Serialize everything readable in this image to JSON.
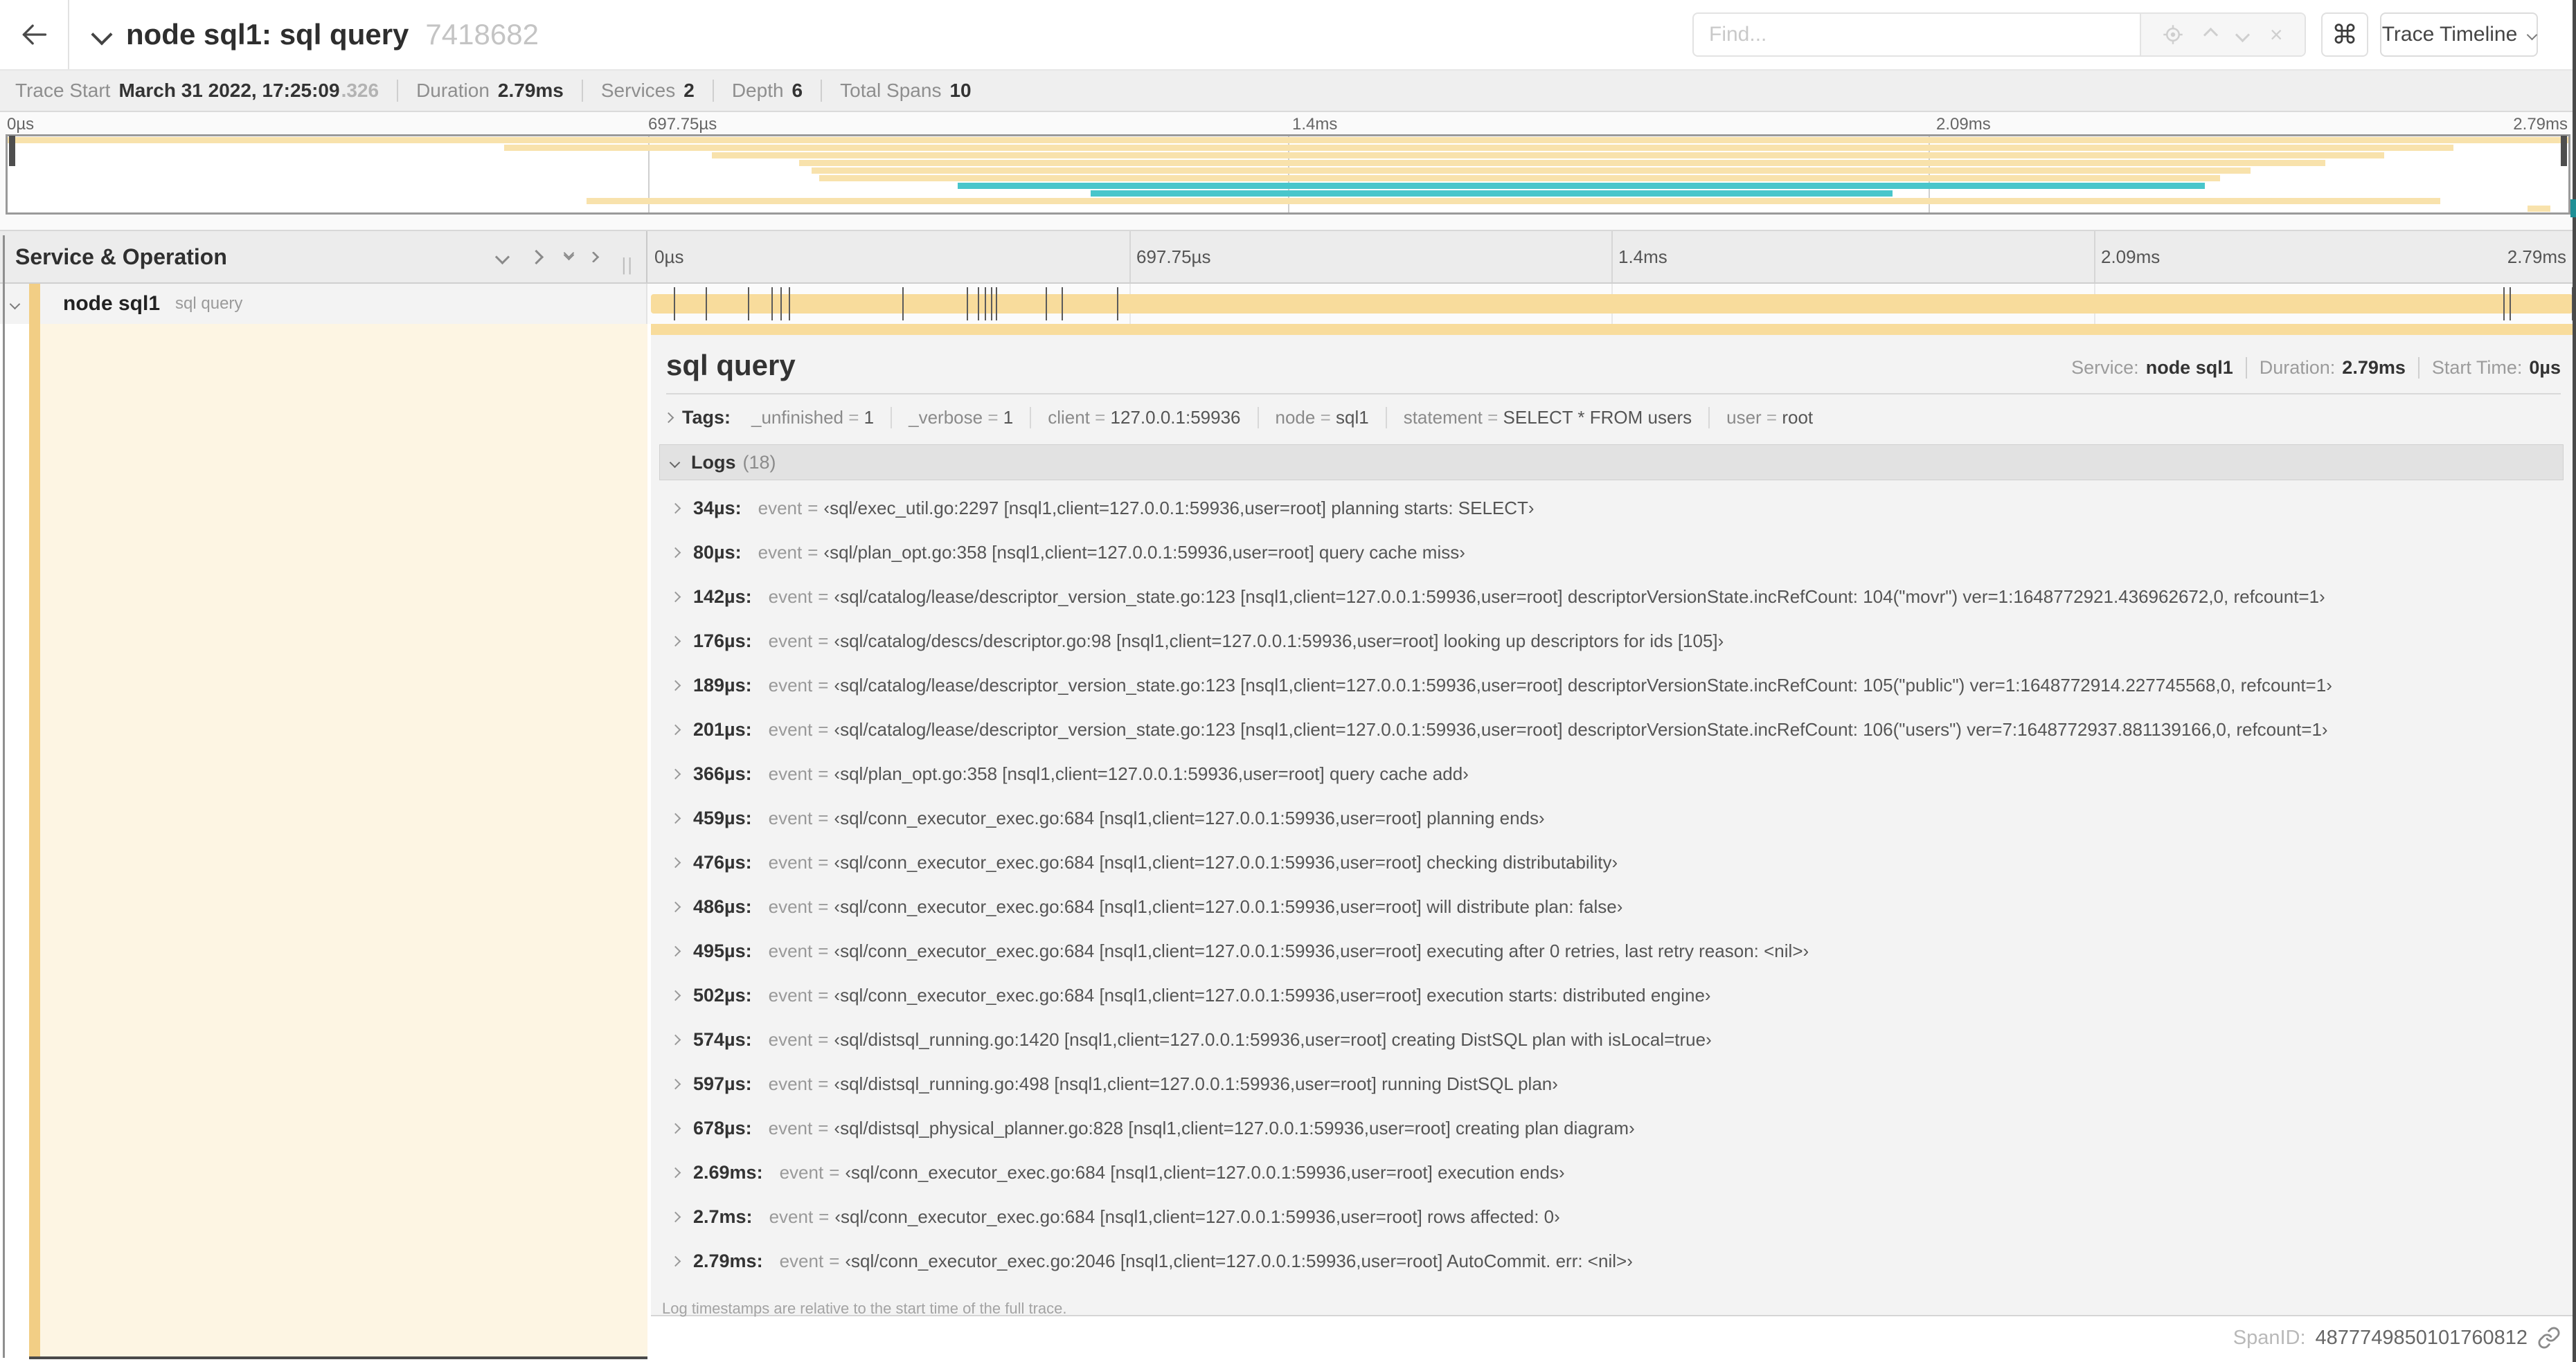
{
  "colors": {
    "tan": "#F8E2AC",
    "teal": "#49C6CB",
    "bar": "#F8DC9C",
    "accent": "#F2CE85",
    "cream": "#FDF5E3"
  },
  "header": {
    "title": "node sql1: sql query",
    "trace_id_short": "7418682",
    "find_placeholder": "Find...",
    "shortcuts_glyph": "⌘",
    "view_selector_label": "Trace Timeline"
  },
  "info_bar": {
    "items": [
      {
        "label": "Trace Start",
        "value": "March 31 2022, 17:25:09",
        "suffix": ".326"
      },
      {
        "label": "Duration",
        "value": "2.79ms",
        "suffix": ""
      },
      {
        "label": "Services",
        "value": "2",
        "suffix": ""
      },
      {
        "label": "Depth",
        "value": "6",
        "suffix": ""
      },
      {
        "label": "Total Spans",
        "value": "10",
        "suffix": ""
      }
    ]
  },
  "timeline": {
    "duration_us": 2790,
    "ticks": [
      "0µs",
      "697.75µs",
      "1.4ms",
      "2.09ms",
      "2.79ms"
    ]
  },
  "minimap": {
    "rows": [
      {
        "start": 0,
        "end": 100,
        "color": "tan"
      },
      {
        "start": 19.4,
        "end": 95.5,
        "color": "tan"
      },
      {
        "start": 27.5,
        "end": 92.8,
        "color": "tan"
      },
      {
        "start": 30.9,
        "end": 90.5,
        "color": "tan"
      },
      {
        "start": 31.4,
        "end": 87.6,
        "color": "tan"
      },
      {
        "start": 31.7,
        "end": 86.4,
        "color": "tan"
      },
      {
        "start": 37.1,
        "end": 85.8,
        "color": "teal"
      },
      {
        "start": 42.3,
        "end": 73.6,
        "color": "teal"
      },
      {
        "start": 22.6,
        "end": 95.0,
        "color": "tan"
      },
      {
        "start": 98.4,
        "end": 99.3,
        "color": "tan"
      }
    ]
  },
  "columns_header": {
    "title": "Service & Operation",
    "grip": "||"
  },
  "span_row": {
    "service": "node sql1",
    "operation": "sql query"
  },
  "detail": {
    "title": "sql query",
    "meta": [
      {
        "label": "Service:",
        "value": "node sql1"
      },
      {
        "label": "Duration:",
        "value": "2.79ms"
      },
      {
        "label": "Start Time:",
        "value": "0µs"
      }
    ],
    "tags_label": "Tags:",
    "eq_sign": "=",
    "tags": [
      {
        "key": "_unfinished",
        "value": "1"
      },
      {
        "key": "_verbose",
        "value": "1"
      },
      {
        "key": "client",
        "value": "127.0.0.1:59936"
      },
      {
        "key": "node",
        "value": "sql1"
      },
      {
        "key": "statement",
        "value": "SELECT * FROM users"
      },
      {
        "key": "user",
        "value": "root"
      }
    ],
    "logs_label": "Logs",
    "logs_count": "(18)",
    "logs": [
      {
        "time": "34µs:",
        "t_us": 34,
        "field": "event",
        "value": "‹sql/exec_util.go:2297 [nsql1,client=127.0.0.1:59936,user=root] planning starts: SELECT›"
      },
      {
        "time": "80µs:",
        "t_us": 80,
        "field": "event",
        "value": "‹sql/plan_opt.go:358 [nsql1,client=127.0.0.1:59936,user=root] query cache miss›"
      },
      {
        "time": "142µs:",
        "t_us": 142,
        "field": "event",
        "value": "‹sql/catalog/lease/descriptor_version_state.go:123 [nsql1,client=127.0.0.1:59936,user=root] descriptorVersionState.incRefCount: 104(\"movr\") ver=1:1648772921.436962672,0, refcount=1›"
      },
      {
        "time": "176µs:",
        "t_us": 176,
        "field": "event",
        "value": "‹sql/catalog/descs/descriptor.go:98 [nsql1,client=127.0.0.1:59936,user=root] looking up descriptors for ids [105]›"
      },
      {
        "time": "189µs:",
        "t_us": 189,
        "field": "event",
        "value": "‹sql/catalog/lease/descriptor_version_state.go:123 [nsql1,client=127.0.0.1:59936,user=root] descriptorVersionState.incRefCount: 105(\"public\") ver=1:1648772914.227745568,0, refcount=1›"
      },
      {
        "time": "201µs:",
        "t_us": 201,
        "field": "event",
        "value": "‹sql/catalog/lease/descriptor_version_state.go:123 [nsql1,client=127.0.0.1:59936,user=root] descriptorVersionState.incRefCount: 106(\"users\") ver=7:1648772937.881139166,0, refcount=1›"
      },
      {
        "time": "366µs:",
        "t_us": 366,
        "field": "event",
        "value": "‹sql/plan_opt.go:358 [nsql1,client=127.0.0.1:59936,user=root] query cache add›"
      },
      {
        "time": "459µs:",
        "t_us": 459,
        "field": "event",
        "value": "‹sql/conn_executor_exec.go:684 [nsql1,client=127.0.0.1:59936,user=root] planning ends›"
      },
      {
        "time": "476µs:",
        "t_us": 476,
        "field": "event",
        "value": "‹sql/conn_executor_exec.go:684 [nsql1,client=127.0.0.1:59936,user=root] checking distributability›"
      },
      {
        "time": "486µs:",
        "t_us": 486,
        "field": "event",
        "value": "‹sql/conn_executor_exec.go:684 [nsql1,client=127.0.0.1:59936,user=root] will distribute plan: false›"
      },
      {
        "time": "495µs:",
        "t_us": 495,
        "field": "event",
        "value": "‹sql/conn_executor_exec.go:684 [nsql1,client=127.0.0.1:59936,user=root] executing after 0 retries, last retry reason: <nil>›"
      },
      {
        "time": "502µs:",
        "t_us": 502,
        "field": "event",
        "value": "‹sql/conn_executor_exec.go:684 [nsql1,client=127.0.0.1:59936,user=root] execution starts: distributed engine›"
      },
      {
        "time": "574µs:",
        "t_us": 574,
        "field": "event",
        "value": "‹sql/distsql_running.go:1420 [nsql1,client=127.0.0.1:59936,user=root] creating DistSQL plan with isLocal=true›"
      },
      {
        "time": "597µs:",
        "t_us": 597,
        "field": "event",
        "value": "‹sql/distsql_running.go:498 [nsql1,client=127.0.0.1:59936,user=root] running DistSQL plan›"
      },
      {
        "time": "678µs:",
        "t_us": 678,
        "field": "event",
        "value": "‹sql/distsql_physical_planner.go:828 [nsql1,client=127.0.0.1:59936,user=root] creating plan diagram›"
      },
      {
        "time": "2.69ms:",
        "t_us": 2690,
        "field": "event",
        "value": "‹sql/conn_executor_exec.go:684 [nsql1,client=127.0.0.1:59936,user=root] execution ends›"
      },
      {
        "time": "2.7ms:",
        "t_us": 2700,
        "field": "event",
        "value": "‹sql/conn_executor_exec.go:684 [nsql1,client=127.0.0.1:59936,user=root] rows affected: 0›"
      },
      {
        "time": "2.79ms:",
        "t_us": 2790,
        "field": "event",
        "value": "‹sql/conn_executor_exec.go:2046 [nsql1,client=127.0.0.1:59936,user=root] AutoCommit. err: <nil>›"
      }
    ],
    "footer_note": "Log timestamps are relative to the start time of the full trace.",
    "span_id_label": "SpanID:",
    "span_id": "4877749850101760812"
  }
}
